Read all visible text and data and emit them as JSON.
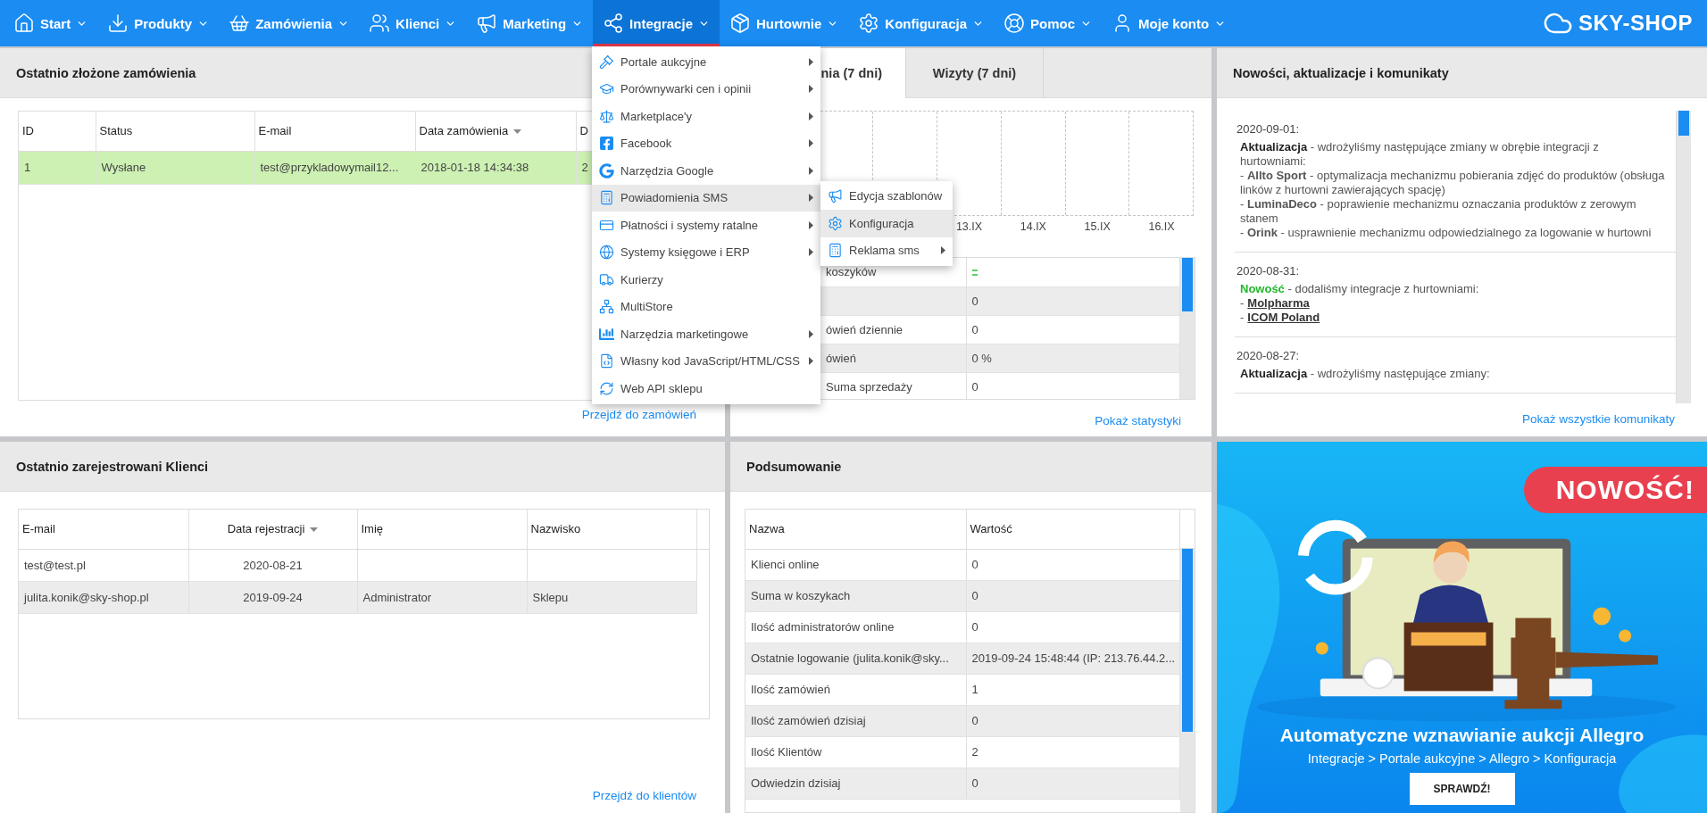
{
  "nav": {
    "items": [
      {
        "label": "Start",
        "selected": false
      },
      {
        "label": "Produkty",
        "selected": false
      },
      {
        "label": "Zamówienia",
        "selected": false
      },
      {
        "label": "Klienci",
        "selected": false
      },
      {
        "label": "Marketing",
        "selected": false
      },
      {
        "label": "Integracje",
        "selected": true
      },
      {
        "label": "Hurtownie",
        "selected": false
      },
      {
        "label": "Konfiguracja",
        "selected": false
      },
      {
        "label": "Pomoc",
        "selected": false
      },
      {
        "label": "Moje konto",
        "selected": false
      }
    ],
    "logo": "SKY-SHOP"
  },
  "integrations_menu": {
    "items": [
      {
        "label": "Portale aukcyjne",
        "submenu": true,
        "selected": false
      },
      {
        "label": "Porównywarki cen i opinii",
        "submenu": true,
        "selected": false
      },
      {
        "label": "Marketplace'y",
        "submenu": true,
        "selected": false
      },
      {
        "label": "Facebook",
        "submenu": true,
        "selected": false
      },
      {
        "label": "Narzędzia Google",
        "submenu": true,
        "selected": false
      },
      {
        "label": "Powiadomienia SMS",
        "submenu": true,
        "selected": true
      },
      {
        "label": "Płatności i systemy ratalne",
        "submenu": true,
        "selected": false
      },
      {
        "label": "Systemy księgowe i ERP",
        "submenu": true,
        "selected": false
      },
      {
        "label": "Kurierzy",
        "submenu": false,
        "selected": false
      },
      {
        "label": "MultiStore",
        "submenu": false,
        "selected": false
      },
      {
        "label": "Narzędzia marketingowe",
        "submenu": true,
        "selected": false
      },
      {
        "label": "Własny kod JavaScript/HTML/CSS",
        "submenu": true,
        "selected": false
      },
      {
        "label": "Web API sklepu",
        "submenu": false,
        "selected": false
      }
    ],
    "submenu": {
      "items": [
        {
          "label": "Edycja szablonów",
          "submenu": false,
          "selected": false
        },
        {
          "label": "Konfiguracja",
          "submenu": false,
          "selected": true
        },
        {
          "label": "Reklama sms",
          "submenu": true,
          "selected": false
        }
      ]
    }
  },
  "orders": {
    "title": "Ostatnio złożone zamówienia",
    "columns": [
      {
        "label": "ID",
        "sorted": false
      },
      {
        "label": "Status",
        "sorted": false
      },
      {
        "label": "E-mail",
        "sorted": false
      },
      {
        "label": "Data zamówienia",
        "sorted": true
      },
      {
        "label": "D",
        "sorted": false
      }
    ],
    "rows": [
      {
        "color": "#cdf1b3",
        "cells": [
          "1",
          "Wysłane",
          "test@przykladowymail12...",
          "2018-01-18 14:34:38",
          "2"
        ]
      }
    ],
    "link": "Przejdź do zamówień"
  },
  "stats": {
    "tabs": [
      {
        "label": "nia (7 dni)",
        "selected": true
      },
      {
        "label": "Wizyty (7 dni)",
        "selected": false
      }
    ],
    "chart_labels": [
      "13.IX",
      "14.IX",
      "15.IX",
      "16.IX"
    ],
    "rows": [
      {
        "kind": "trend",
        "label": "koszyków"
      },
      {
        "kind": "text",
        "value": "0"
      },
      {
        "kind": "text",
        "label": "ówień dziennie",
        "value": "0"
      },
      {
        "kind": "text",
        "label": "ówień",
        "value": "0 %"
      },
      {
        "kind": "text",
        "label": "Suma sprzedaży",
        "value": "0"
      }
    ],
    "link": "Pokaż statystyki"
  },
  "news": {
    "title": "Nowości, aktualizacje i komunikaty",
    "entries": [
      {
        "date": "2020-09-01:",
        "kind": "update",
        "label": "Aktualizacja",
        "intro": "- wdrożyliśmy następujące zmiany w obrębie integracji z hurtowniami:",
        "items": [
          {
            "kind": "text",
            "text": "- **Allto Sport** - optymalizacja mechanizmu pobierania zdjęć do produktów (obsługa linków z hurtowni zawierających spację)"
          },
          {
            "kind": "text",
            "text": "- **LuminaDeco** - poprawienie mechanizmu oznaczania produktów z zerowym stanem"
          },
          {
            "kind": "text",
            "text": "- **Orink** - usprawnienie mechanizmu odpowiedzialnego za logowanie w hurtowni"
          }
        ]
      },
      {
        "date": "2020-08-31:",
        "kind": "new",
        "label": "Nowość",
        "intro": "- dodaliśmy integracje z hurtowniami:",
        "items": [
          {
            "kind": "link",
            "prefix": "-",
            "text": "Molpharma"
          },
          {
            "kind": "link",
            "prefix": "-",
            "text": "ICOM Poland"
          }
        ]
      },
      {
        "date": "2020-08-27:",
        "kind": "update",
        "label": "Aktualizacja",
        "intro": "- wdrożyliśmy następujące zmiany:"
      }
    ],
    "link": "Pokaż wszystkie komunikaty"
  },
  "clients": {
    "title": "Ostatnio zarejestrowani Klienci",
    "columns": [
      {
        "label": "E-mail",
        "sorted": false
      },
      {
        "label": "Data rejestracji",
        "sorted": true
      },
      {
        "label": "Imię",
        "sorted": false
      },
      {
        "label": "Nazwisko",
        "sorted": false
      }
    ],
    "rows": [
      {
        "email": "test@test.pl",
        "date": "2020-08-21"
      },
      {
        "email": "julita.konik@sky-shop.pl",
        "date": "2019-09-24",
        "first_name": "Administrator",
        "last_name": "Sklepu"
      }
    ],
    "link": "Przejdź do klientów"
  },
  "summary": {
    "title": "Podsumowanie",
    "columns": [
      "Nazwa",
      "Wartość"
    ],
    "rows": [
      {
        "name": "Klienci online",
        "value": "0"
      },
      {
        "name": "Suma w koszykach",
        "value": "0"
      },
      {
        "name": "Ilość administratorów online",
        "value": "0"
      },
      {
        "name": "Ostatnie logowanie (julita.konik@sky...",
        "value": "2019-09-24 15:48:44 (IP: 213.76.44.2..."
      },
      {
        "name": "Ilość zamówień",
        "value": "1"
      },
      {
        "name": "Ilość zamówień dzisiaj",
        "value": "0"
      },
      {
        "name": "Ilość Klientów",
        "value": "2"
      },
      {
        "name": "Odwiedzin dzisiaj",
        "value": "0"
      }
    ]
  },
  "banner": {
    "badge": "NOWOŚĆ!",
    "headline": "Automatyczne wznawianie aukcji Allegro",
    "path": "Integracje > Portale aukcyjne > Allegro > Konfiguracja",
    "button": "SPRAWDŹ!"
  }
}
